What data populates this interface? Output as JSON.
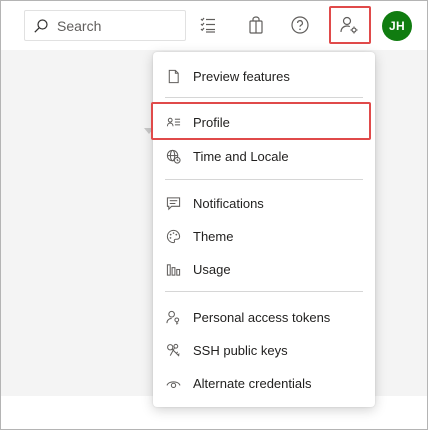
{
  "header": {
    "search": {
      "placeholder": "Search",
      "icon": "search-icon"
    },
    "icons": [
      "list-icon",
      "shopping-bag-icon",
      "help-icon",
      "user-settings-icon"
    ],
    "avatar": {
      "initials": "JH",
      "color": "#107c10"
    }
  },
  "user_menu": {
    "groups": [
      [
        {
          "label": "Preview features",
          "icon": "document-icon"
        }
      ],
      [
        {
          "label": "Profile",
          "icon": "profile-card-icon"
        },
        {
          "label": "Time and Locale",
          "icon": "globe-clock-icon"
        }
      ],
      [
        {
          "label": "Notifications",
          "icon": "chat-icon"
        },
        {
          "label": "Theme",
          "icon": "palette-icon"
        },
        {
          "label": "Usage",
          "icon": "bar-chart-icon"
        }
      ],
      [
        {
          "label": "Personal access tokens",
          "icon": "person-key-icon"
        },
        {
          "label": "SSH public keys",
          "icon": "keys-icon"
        },
        {
          "label": "Alternate credentials",
          "icon": "eye-icon"
        }
      ]
    ]
  },
  "colors": {
    "highlight": "#e04a4a",
    "accent": "#0078d4"
  }
}
